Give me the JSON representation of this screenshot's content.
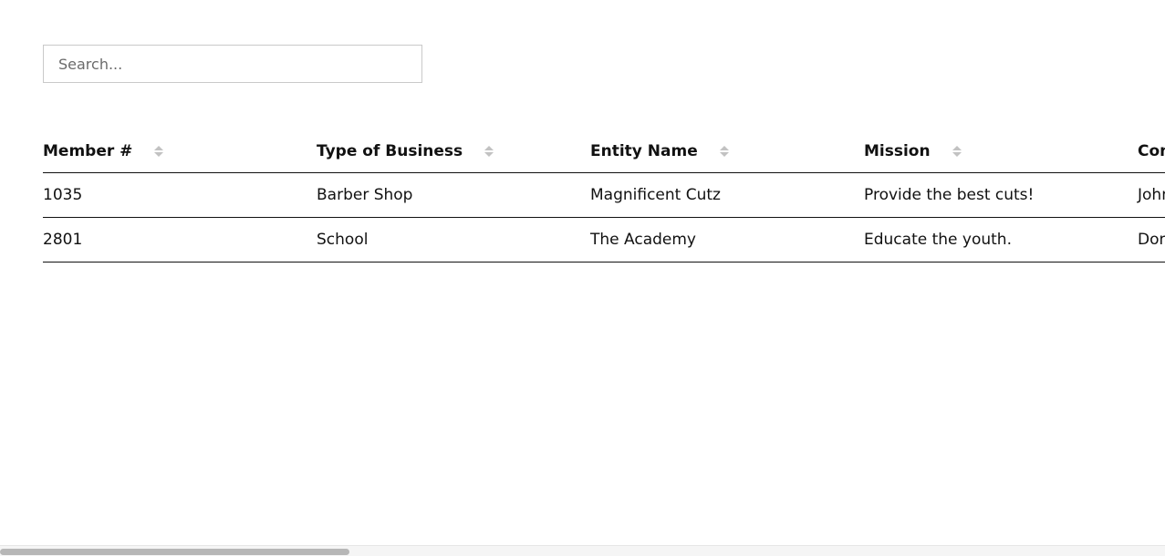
{
  "search": {
    "placeholder": "Search...",
    "value": ""
  },
  "table": {
    "columns": [
      {
        "label": "Member #",
        "sort_icon": "sort-icon"
      },
      {
        "label": "Type of Business",
        "sort_icon": "sort-icon"
      },
      {
        "label": "Entity Name",
        "sort_icon": "sort-icon"
      },
      {
        "label": "Mission",
        "sort_icon": "sort-icon"
      },
      {
        "label": "Contact",
        "sort_icon": "sort-icon"
      }
    ],
    "rows": [
      [
        "1035",
        "Barber Shop",
        "Magnificent Cutz",
        "Provide the best cuts!",
        "John"
      ],
      [
        "2801",
        "School",
        "The Academy",
        "Educate the youth.",
        "Don"
      ]
    ]
  },
  "scrollbar": {
    "position_fraction": 0.0,
    "visible_fraction": 0.3
  },
  "colors": {
    "border": "#111111",
    "sort_icon": "#c2c2c2",
    "scroll_thumb": "#b7b7b7"
  }
}
